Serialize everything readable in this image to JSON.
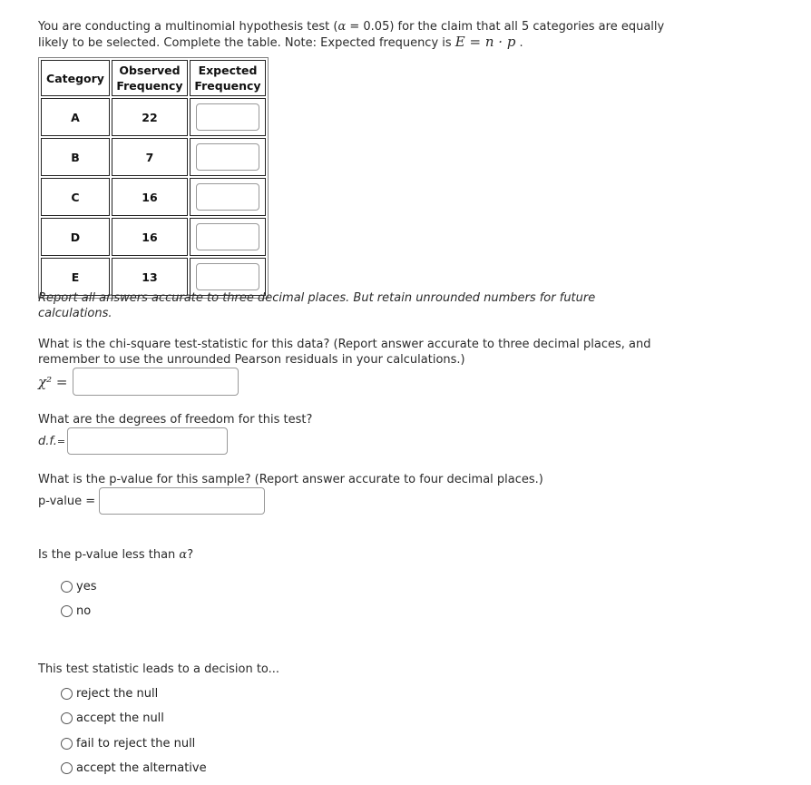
{
  "intro": {
    "line1_pre": "You are conducting a multinomial hypothesis test (",
    "alpha_symbol": "α",
    "line1_mid": " = 0.05) for the claim that all 5 categories are equally",
    "line2_pre": "likely to be selected. Complete the table. Note: Expected frequency is ",
    "formula": "E = n · p",
    "line2_post": " ."
  },
  "table": {
    "headers": [
      "Category",
      "Observed Frequency",
      "Expected Frequency"
    ],
    "header_lines": {
      "observed": [
        "Observed",
        "Frequency"
      ],
      "expected": [
        "Expected",
        "Frequency"
      ]
    },
    "rows": [
      {
        "category": "A",
        "observed": "22",
        "expected": ""
      },
      {
        "category": "B",
        "observed": "7",
        "expected": ""
      },
      {
        "category": "C",
        "observed": "16",
        "expected": ""
      },
      {
        "category": "D",
        "observed": "16",
        "expected": ""
      },
      {
        "category": "E",
        "observed": "13",
        "expected": ""
      }
    ]
  },
  "note": {
    "line1": "Report all answers accurate to three decimal places. But retain unrounded numbers for future",
    "line2": "calculations."
  },
  "chi_square": {
    "question_line1": "What is the chi-square test-statistic for this data? (Report answer accurate to three decimal places, and",
    "question_line2": "remember to use the unrounded Pearson residuals in your calculations.)",
    "label": "χ² =",
    "value": ""
  },
  "df": {
    "question": "What are the degrees of freedom for this test?",
    "label": "d.f.",
    "equals": "=",
    "value": ""
  },
  "pvalue": {
    "question": "What is the p-value for this sample? (Report answer accurate to four decimal places.)",
    "label": "p-value =",
    "value": ""
  },
  "compare": {
    "question_pre": "Is the p-value less than ",
    "alpha_symbol": "α",
    "question_post": "?",
    "options": [
      "yes",
      "no"
    ]
  },
  "decision": {
    "question": "This test statistic leads to a decision to...",
    "options": [
      "reject the null",
      "accept the null",
      "fail to reject the null",
      "accept the alternative"
    ]
  }
}
